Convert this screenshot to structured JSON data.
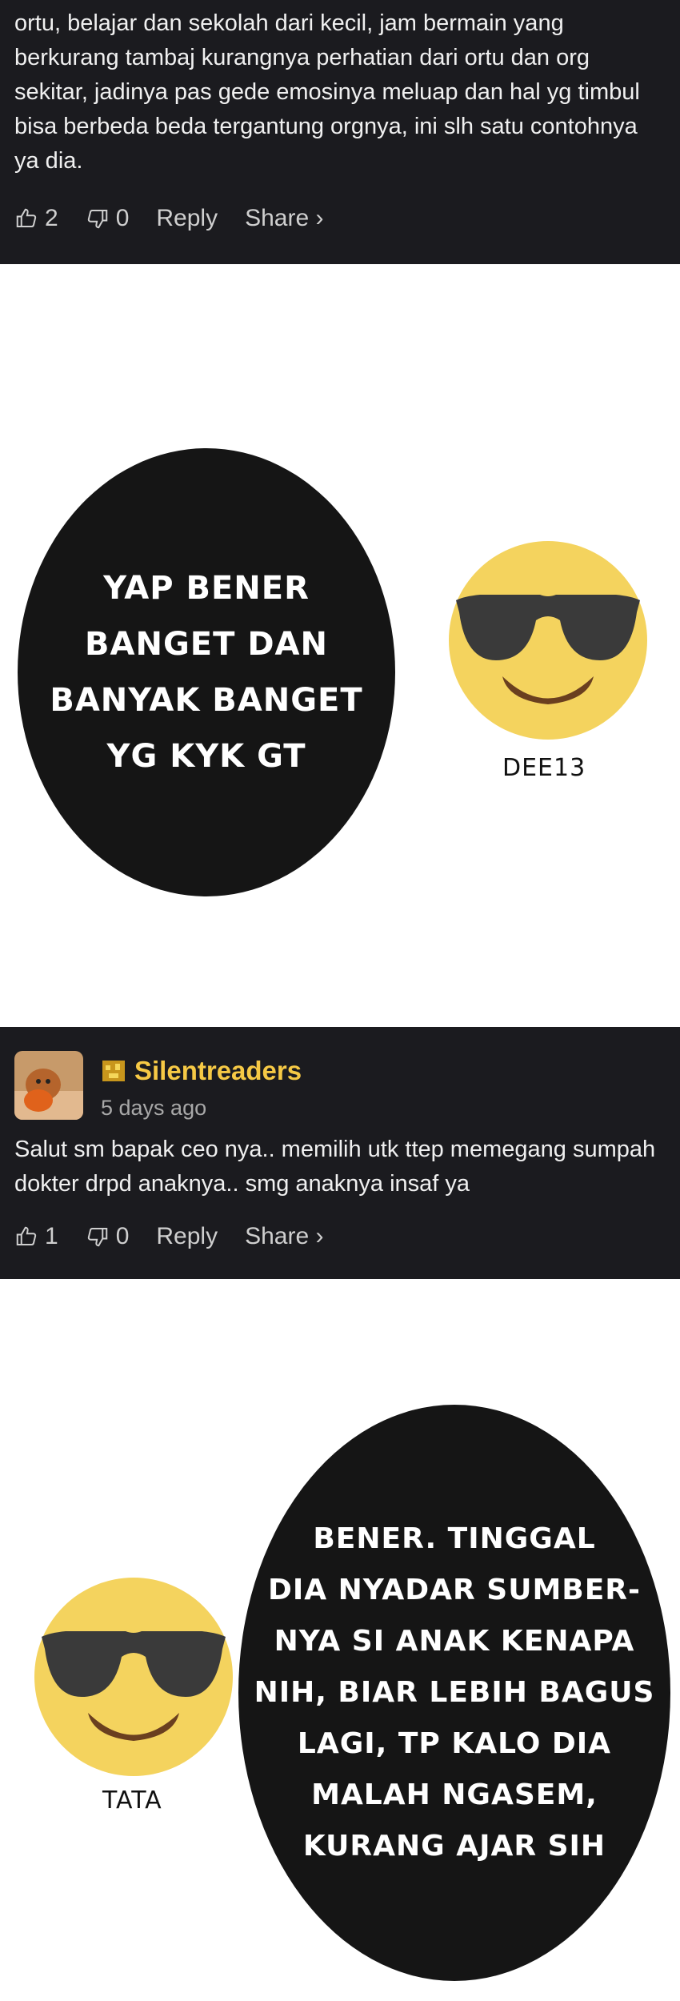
{
  "comment1": {
    "text": "ortu, belajar dan sekolah dari kecil, jam bermain yang berkurang tambaj kurangnya perhatian dari ortu dan org sekitar, jadinya pas gede emosinya meluap dan hal yg timbul bisa berbeda beda tergantung orgnya, ini slh satu contohnya ya dia.",
    "likes": "2",
    "dislikes": "0",
    "reply": "Reply",
    "share": "Share ›"
  },
  "bubble1": {
    "lines": [
      "YAP BENER",
      "BANGET DAN",
      "BANYAK BANGET",
      "YG KYK GT"
    ],
    "signature": "DEE13"
  },
  "comment2": {
    "username": "Silentreaders",
    "time": "5 days ago",
    "text": "Salut sm bapak ceo nya.. memilih utk ttep memegang sumpah dokter drpd anaknya.. smg anaknya insaf ya",
    "likes": "1",
    "dislikes": "0",
    "reply": "Reply",
    "share": "Share ›"
  },
  "bubble2": {
    "lines": [
      "BENER. TINGGAL",
      "DIA NYADAR SUMBER-",
      "NYA SI ANAK KENAPA",
      "NIH, BIAR LEBIH BAGUS",
      "LAGI, TP KALO DIA",
      "MALAH NGASEM,",
      "KURANG AJAR SIH"
    ],
    "signature": "TATA"
  },
  "colors": {
    "panel_bg": "#1b1b1f",
    "username": "#f6c945",
    "emoji_face": "#f4d35e",
    "bubble_bg": "#151515"
  },
  "icons": [
    "thumbs-up-icon",
    "thumbs-down-icon",
    "user-avatar",
    "badge-icon",
    "sunglasses-emoji"
  ]
}
